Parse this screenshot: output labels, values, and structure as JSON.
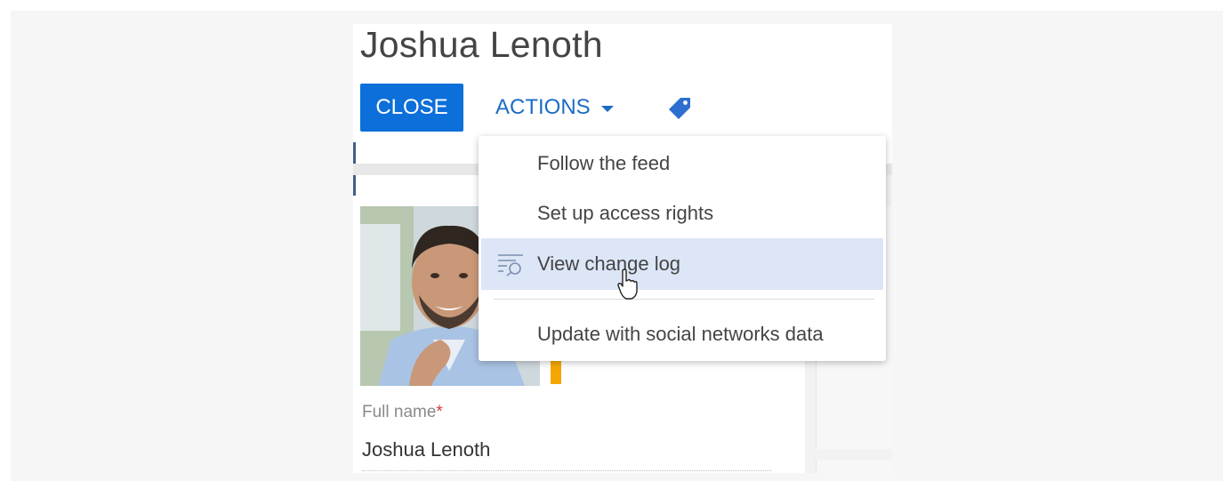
{
  "record": {
    "title": "Joshua Lenoth"
  },
  "toolbar": {
    "close_label": "CLOSE",
    "actions_label": "ACTIONS",
    "tag_icon": "tag-icon"
  },
  "actions_menu": {
    "items": [
      {
        "label": "Follow the feed"
      },
      {
        "label": "Set up access rights"
      },
      {
        "label": "View change log",
        "icon": "change-log-icon",
        "hovered": true
      },
      {
        "label": "Update with social networks data"
      }
    ]
  },
  "profile": {
    "full_name_label": "Full name",
    "required_mark": "*",
    "full_name_value": "Joshua Lenoth"
  },
  "colors": {
    "primary_button": "#0d6fd9",
    "link": "#1c6cc4",
    "hover_row": "#dce6f7",
    "accent": "#f5a700",
    "required": "#d53b3b"
  }
}
